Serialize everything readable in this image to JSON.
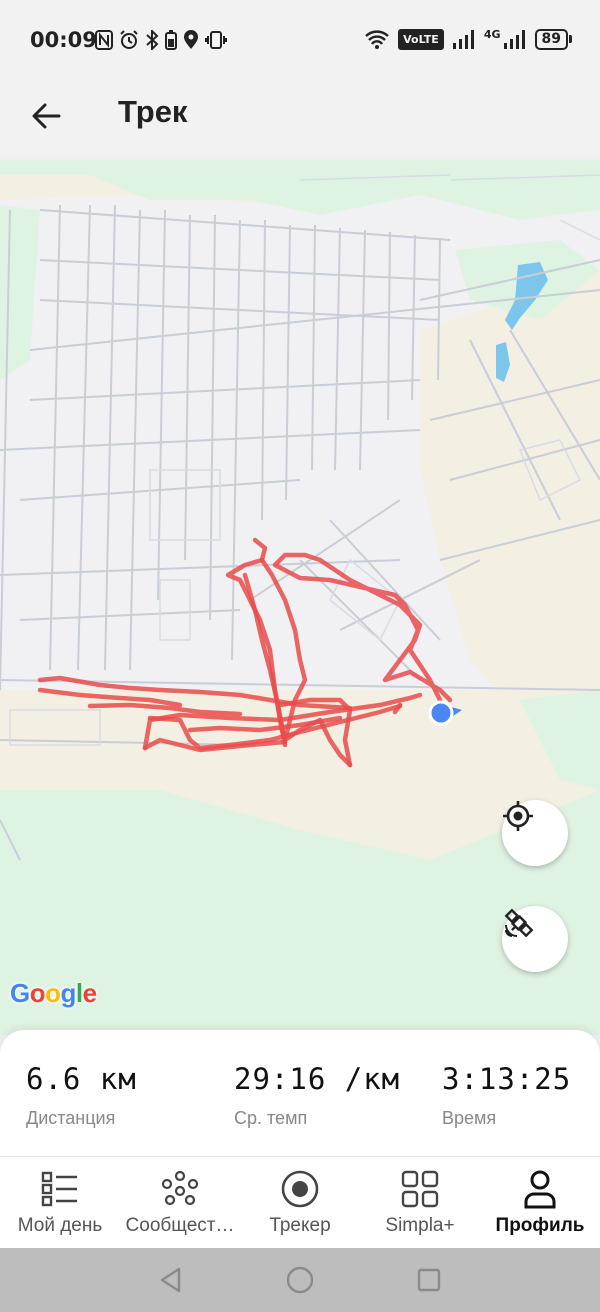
{
  "status_bar": {
    "time": "00:09",
    "network_label": "4G",
    "volte_label": "VoLTE",
    "battery": "89"
  },
  "header": {
    "title": "Трек"
  },
  "map": {
    "attribution": "Google",
    "colors": {
      "track": "#e84b4b",
      "park": "#dff3e3",
      "sand": "#f3efe2",
      "water": "#7cc6ec",
      "road": "#c9cdd6",
      "location": "#4a86f7"
    }
  },
  "stats": [
    {
      "value": "6.6 км",
      "label": "Дистанция"
    },
    {
      "value": "29:16 /км",
      "label": "Ср. темп"
    },
    {
      "value": "3:13:25",
      "label": "Время"
    }
  ],
  "bottom_nav": {
    "items": [
      {
        "label": "Мой день",
        "icon": "list-icon",
        "active": false
      },
      {
        "label": "Сообщест…",
        "icon": "community-icon",
        "active": false
      },
      {
        "label": "Трекер",
        "icon": "record-icon",
        "active": false
      },
      {
        "label": "Simpla+",
        "icon": "grid-icon",
        "active": false
      },
      {
        "label": "Профиль",
        "icon": "profile-icon",
        "active": true
      }
    ]
  }
}
